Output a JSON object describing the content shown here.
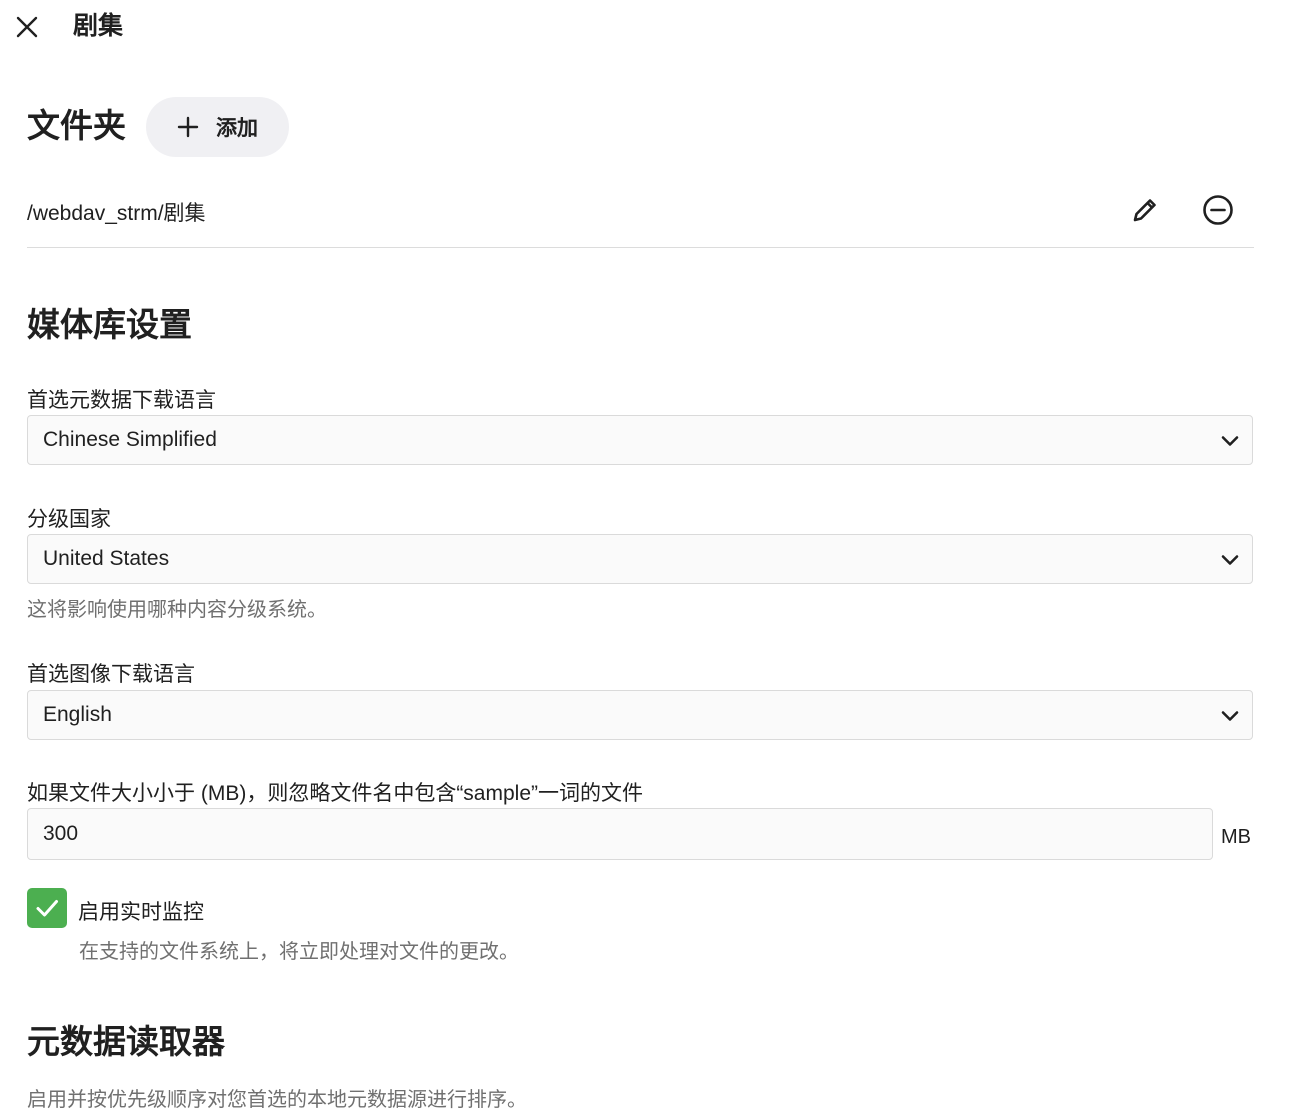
{
  "header": {
    "title": "剧集",
    "close_icon": "close-icon"
  },
  "folders": {
    "title": "文件夹",
    "add_label": "添加",
    "items": [
      {
        "path": "/webdav_strm/剧集"
      }
    ]
  },
  "library_settings": {
    "title": "媒体库设置",
    "metadata_language": {
      "label": "首选元数据下载语言",
      "value": "Chinese Simplified"
    },
    "rating_country": {
      "label": "分级国家",
      "value": "United States",
      "help": "这将影响使用哪种内容分级系统。"
    },
    "image_language": {
      "label": "首选图像下载语言",
      "value": "English"
    },
    "sample_ignore": {
      "label": "如果文件大小小于 (MB)，则忽略文件名中包含“sample”一词的文件",
      "value": "300",
      "unit": "MB"
    },
    "realtime_monitor": {
      "label": "启用实时监控",
      "help": "在支持的文件系统上，将立即处理对文件的更改。",
      "checked": true
    }
  },
  "metadata_readers": {
    "title": "元数据读取器",
    "help": "启用并按优先级顺序对您首选的本地元数据源进行排序。"
  },
  "colors": {
    "accent_green": "#4caf50",
    "button_bg": "#f0f0f3",
    "help_text": "#707070"
  }
}
